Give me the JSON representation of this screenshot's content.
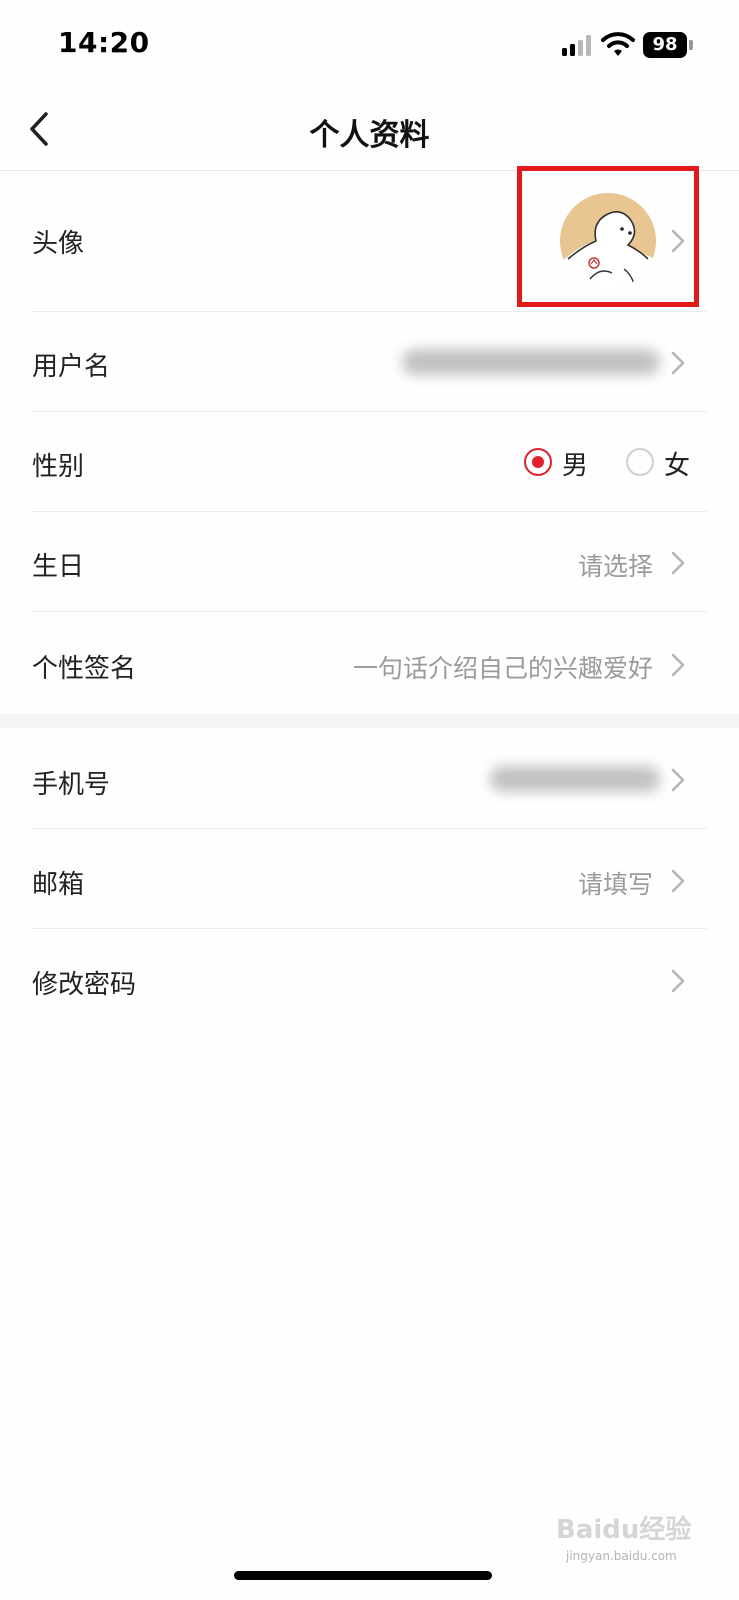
{
  "status_bar": {
    "time": "14:20",
    "battery": "98"
  },
  "nav": {
    "title": "个人资料"
  },
  "rows": {
    "avatar": {
      "label": "头像"
    },
    "username": {
      "label": "用户名"
    },
    "gender": {
      "label": "性别",
      "options": [
        "男",
        "女"
      ],
      "selected": "男"
    },
    "birthday": {
      "label": "生日",
      "placeholder": "请选择"
    },
    "signature": {
      "label": "个性签名",
      "placeholder": "一句话介绍自己的兴趣爱好"
    },
    "phone": {
      "label": "手机号"
    },
    "email": {
      "label": "邮箱",
      "placeholder": "请填写"
    },
    "password": {
      "label": "修改密码"
    }
  },
  "colors": {
    "accent": "#e0202a",
    "highlight_box": "#e11b1b",
    "avatar_bg": "#e8c591"
  },
  "watermark": {
    "text": "Baidu经验",
    "url": "jingyan.baidu.com"
  }
}
